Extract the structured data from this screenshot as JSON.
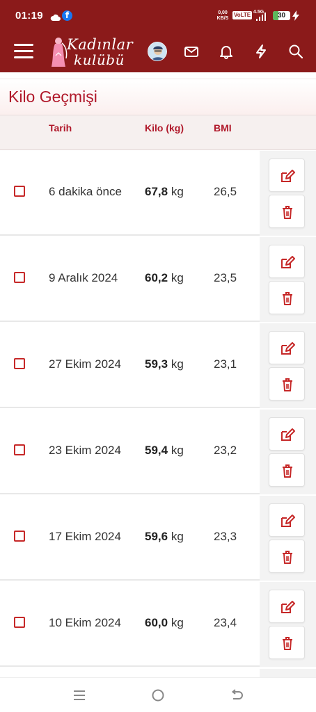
{
  "status_bar": {
    "time": "01:19",
    "cloud_icon": "cloud-icon",
    "fb_icon": "facebook-icon",
    "fb_glyph": "f",
    "speed_value": "0,00",
    "speed_unit": "KB/S",
    "volte": "VoLTE",
    "network": "4.5G",
    "battery_level": "30",
    "battery_fraction": 0.3,
    "charging_icon": "bolt-icon"
  },
  "header": {
    "menu_icon": "hamburger-icon",
    "logo_line1": "Kadınlar",
    "logo_line2": "kulübü",
    "avatar_icon": "avatar-icon",
    "icons": [
      "mail-icon",
      "bell-icon",
      "lightning-icon",
      "search-icon"
    ]
  },
  "page": {
    "title": "Kilo Geçmişi"
  },
  "table": {
    "headers": {
      "date": "Tarih",
      "weight": "Kilo (kg)",
      "bmi": "BMI"
    },
    "unit": "kg",
    "rows": [
      {
        "date": "6 dakika önce",
        "weight": "67,8",
        "bmi": "26,5"
      },
      {
        "date": "9 Aralık 2024",
        "weight": "60,2",
        "bmi": "23,5"
      },
      {
        "date": "27 Ekim 2024",
        "weight": "59,3",
        "bmi": "23,1"
      },
      {
        "date": "23 Ekim 2024",
        "weight": "59,4",
        "bmi": "23,2"
      },
      {
        "date": "17 Ekim 2024",
        "weight": "59,6",
        "bmi": "23,3"
      },
      {
        "date": "10 Ekim 2024",
        "weight": "60,0",
        "bmi": "23,4"
      }
    ],
    "edit_icon": "edit-icon",
    "delete_icon": "trash-icon"
  },
  "nav_bar": {
    "icons": [
      "recent-apps-icon",
      "home-icon",
      "back-icon"
    ]
  },
  "colors": {
    "brand": "#8b1a1a",
    "accent": "#b0182a",
    "action_red": "#c62828"
  }
}
